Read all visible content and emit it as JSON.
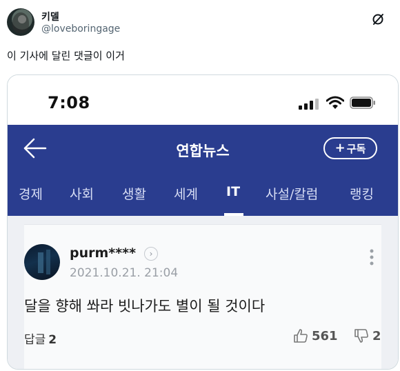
{
  "tweet": {
    "display_name": "키델",
    "handle": "@loveboringage",
    "text": "이 기사에 달린 댓글이 이거"
  },
  "screenshot": {
    "status_bar": {
      "time": "7:08"
    },
    "app_bar": {
      "title": "연합뉴스",
      "subscribe_label": "구독"
    },
    "tabs": [
      {
        "label": "경제"
      },
      {
        "label": "사회"
      },
      {
        "label": "생활"
      },
      {
        "label": "세계"
      },
      {
        "label": "IT",
        "active": true
      },
      {
        "label": "사설/칼럼"
      },
      {
        "label": "랭킹"
      }
    ],
    "comment": {
      "username": "purm****",
      "timestamp": "2021.10.21. 21:04",
      "text": "달을 향해 쏴라 빗나가도 별이 될 것이다",
      "reply_label": "답글",
      "reply_count": "2",
      "likes": "561",
      "dislikes": "2"
    }
  },
  "colors": {
    "app_bar": "#2a3d8f",
    "handle": "#536471"
  },
  "icons": [
    "grok-icon",
    "signal-icon",
    "wifi-icon",
    "battery-icon",
    "back-arrow-icon",
    "more-icon",
    "thumbs-up-icon",
    "thumbs-down-icon"
  ]
}
